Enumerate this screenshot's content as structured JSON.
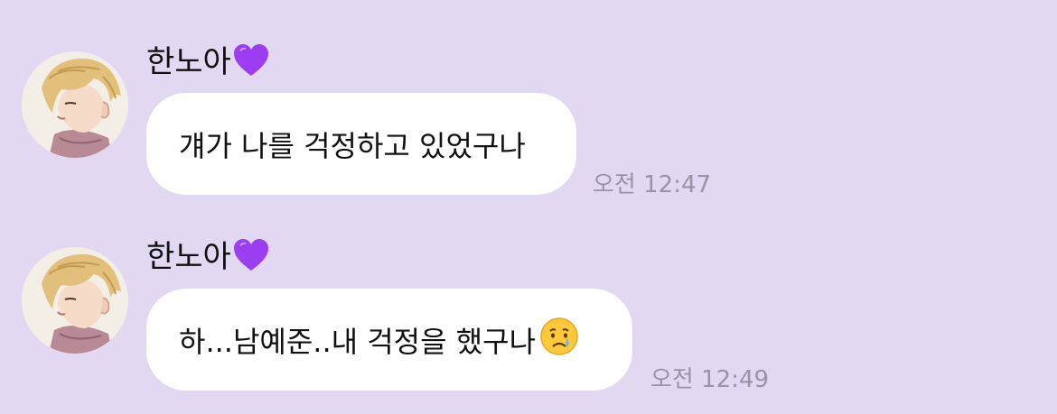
{
  "messages": [
    {
      "sender": "한노아",
      "sender_icon": "purple-heart-icon",
      "text": "걔가 나를 걱정하고 있었구나",
      "time": "오전 12:47"
    },
    {
      "sender": "한노아",
      "sender_icon": "purple-heart-icon",
      "text": "하...남예준..내 걱정을 했구나",
      "text_icon": "crying-face-icon",
      "time": "오전 12:49"
    }
  ],
  "colors": {
    "background": "#e2d8f1",
    "bubble": "#ffffff",
    "time_text": "#9a93a6",
    "heart": "#9b3df0"
  }
}
